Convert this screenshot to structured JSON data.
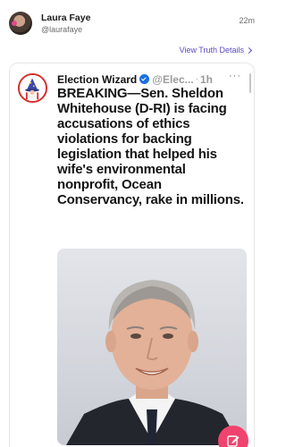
{
  "post": {
    "author_name": "Laura Faye",
    "author_handle": "@laurafaye",
    "time": "22m",
    "view_details": "View Truth Details"
  },
  "quoted": {
    "name": "Election Wizard",
    "handle": "@Elec...",
    "separator": "·",
    "time": "1h",
    "more": "···",
    "text": "BREAKING—Sen. Sheldon Whitehouse (D-RI) is facing accusations of ethics violations for backing legislation that helped his wife's environmental nonprofit, Ocean Conservancy, rake in millions."
  },
  "icons": {
    "chevron": "chevron-right-icon",
    "verified": "verified-badge-icon",
    "compose": "compose-icon",
    "wizard": "wizard-avatar-icon"
  },
  "colors": {
    "accent_link": "#5b4bc4",
    "fab": "#f0436d",
    "verified": "#1d6fe0",
    "avatar_ring": "#d62c2c"
  }
}
